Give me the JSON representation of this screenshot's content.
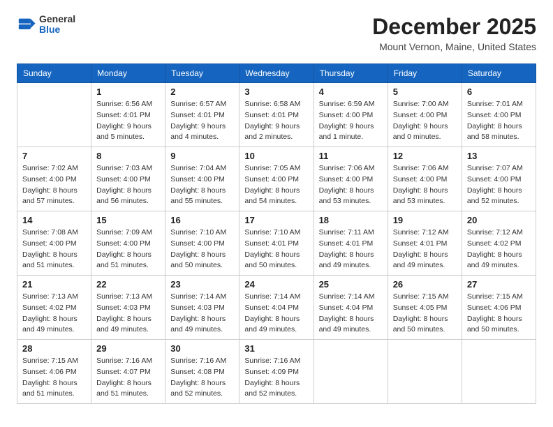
{
  "header": {
    "logo": {
      "general": "General",
      "blue": "Blue"
    },
    "title": "December 2025",
    "location": "Mount Vernon, Maine, United States"
  },
  "weekdays": [
    "Sunday",
    "Monday",
    "Tuesday",
    "Wednesday",
    "Thursday",
    "Friday",
    "Saturday"
  ],
  "weeks": [
    [
      {
        "day": "",
        "info": ""
      },
      {
        "day": "1",
        "info": "Sunrise: 6:56 AM\nSunset: 4:01 PM\nDaylight: 9 hours\nand 5 minutes."
      },
      {
        "day": "2",
        "info": "Sunrise: 6:57 AM\nSunset: 4:01 PM\nDaylight: 9 hours\nand 4 minutes."
      },
      {
        "day": "3",
        "info": "Sunrise: 6:58 AM\nSunset: 4:01 PM\nDaylight: 9 hours\nand 2 minutes."
      },
      {
        "day": "4",
        "info": "Sunrise: 6:59 AM\nSunset: 4:00 PM\nDaylight: 9 hours\nand 1 minute."
      },
      {
        "day": "5",
        "info": "Sunrise: 7:00 AM\nSunset: 4:00 PM\nDaylight: 9 hours\nand 0 minutes."
      },
      {
        "day": "6",
        "info": "Sunrise: 7:01 AM\nSunset: 4:00 PM\nDaylight: 8 hours\nand 58 minutes."
      }
    ],
    [
      {
        "day": "7",
        "info": "Sunrise: 7:02 AM\nSunset: 4:00 PM\nDaylight: 8 hours\nand 57 minutes."
      },
      {
        "day": "8",
        "info": "Sunrise: 7:03 AM\nSunset: 4:00 PM\nDaylight: 8 hours\nand 56 minutes."
      },
      {
        "day": "9",
        "info": "Sunrise: 7:04 AM\nSunset: 4:00 PM\nDaylight: 8 hours\nand 55 minutes."
      },
      {
        "day": "10",
        "info": "Sunrise: 7:05 AM\nSunset: 4:00 PM\nDaylight: 8 hours\nand 54 minutes."
      },
      {
        "day": "11",
        "info": "Sunrise: 7:06 AM\nSunset: 4:00 PM\nDaylight: 8 hours\nand 53 minutes."
      },
      {
        "day": "12",
        "info": "Sunrise: 7:06 AM\nSunset: 4:00 PM\nDaylight: 8 hours\nand 53 minutes."
      },
      {
        "day": "13",
        "info": "Sunrise: 7:07 AM\nSunset: 4:00 PM\nDaylight: 8 hours\nand 52 minutes."
      }
    ],
    [
      {
        "day": "14",
        "info": "Sunrise: 7:08 AM\nSunset: 4:00 PM\nDaylight: 8 hours\nand 51 minutes."
      },
      {
        "day": "15",
        "info": "Sunrise: 7:09 AM\nSunset: 4:00 PM\nDaylight: 8 hours\nand 51 minutes."
      },
      {
        "day": "16",
        "info": "Sunrise: 7:10 AM\nSunset: 4:00 PM\nDaylight: 8 hours\nand 50 minutes."
      },
      {
        "day": "17",
        "info": "Sunrise: 7:10 AM\nSunset: 4:01 PM\nDaylight: 8 hours\nand 50 minutes."
      },
      {
        "day": "18",
        "info": "Sunrise: 7:11 AM\nSunset: 4:01 PM\nDaylight: 8 hours\nand 49 minutes."
      },
      {
        "day": "19",
        "info": "Sunrise: 7:12 AM\nSunset: 4:01 PM\nDaylight: 8 hours\nand 49 minutes."
      },
      {
        "day": "20",
        "info": "Sunrise: 7:12 AM\nSunset: 4:02 PM\nDaylight: 8 hours\nand 49 minutes."
      }
    ],
    [
      {
        "day": "21",
        "info": "Sunrise: 7:13 AM\nSunset: 4:02 PM\nDaylight: 8 hours\nand 49 minutes."
      },
      {
        "day": "22",
        "info": "Sunrise: 7:13 AM\nSunset: 4:03 PM\nDaylight: 8 hours\nand 49 minutes."
      },
      {
        "day": "23",
        "info": "Sunrise: 7:14 AM\nSunset: 4:03 PM\nDaylight: 8 hours\nand 49 minutes."
      },
      {
        "day": "24",
        "info": "Sunrise: 7:14 AM\nSunset: 4:04 PM\nDaylight: 8 hours\nand 49 minutes."
      },
      {
        "day": "25",
        "info": "Sunrise: 7:14 AM\nSunset: 4:04 PM\nDaylight: 8 hours\nand 49 minutes."
      },
      {
        "day": "26",
        "info": "Sunrise: 7:15 AM\nSunset: 4:05 PM\nDaylight: 8 hours\nand 50 minutes."
      },
      {
        "day": "27",
        "info": "Sunrise: 7:15 AM\nSunset: 4:06 PM\nDaylight: 8 hours\nand 50 minutes."
      }
    ],
    [
      {
        "day": "28",
        "info": "Sunrise: 7:15 AM\nSunset: 4:06 PM\nDaylight: 8 hours\nand 51 minutes."
      },
      {
        "day": "29",
        "info": "Sunrise: 7:16 AM\nSunset: 4:07 PM\nDaylight: 8 hours\nand 51 minutes."
      },
      {
        "day": "30",
        "info": "Sunrise: 7:16 AM\nSunset: 4:08 PM\nDaylight: 8 hours\nand 52 minutes."
      },
      {
        "day": "31",
        "info": "Sunrise: 7:16 AM\nSunset: 4:09 PM\nDaylight: 8 hours\nand 52 minutes."
      },
      {
        "day": "",
        "info": ""
      },
      {
        "day": "",
        "info": ""
      },
      {
        "day": "",
        "info": ""
      }
    ]
  ]
}
